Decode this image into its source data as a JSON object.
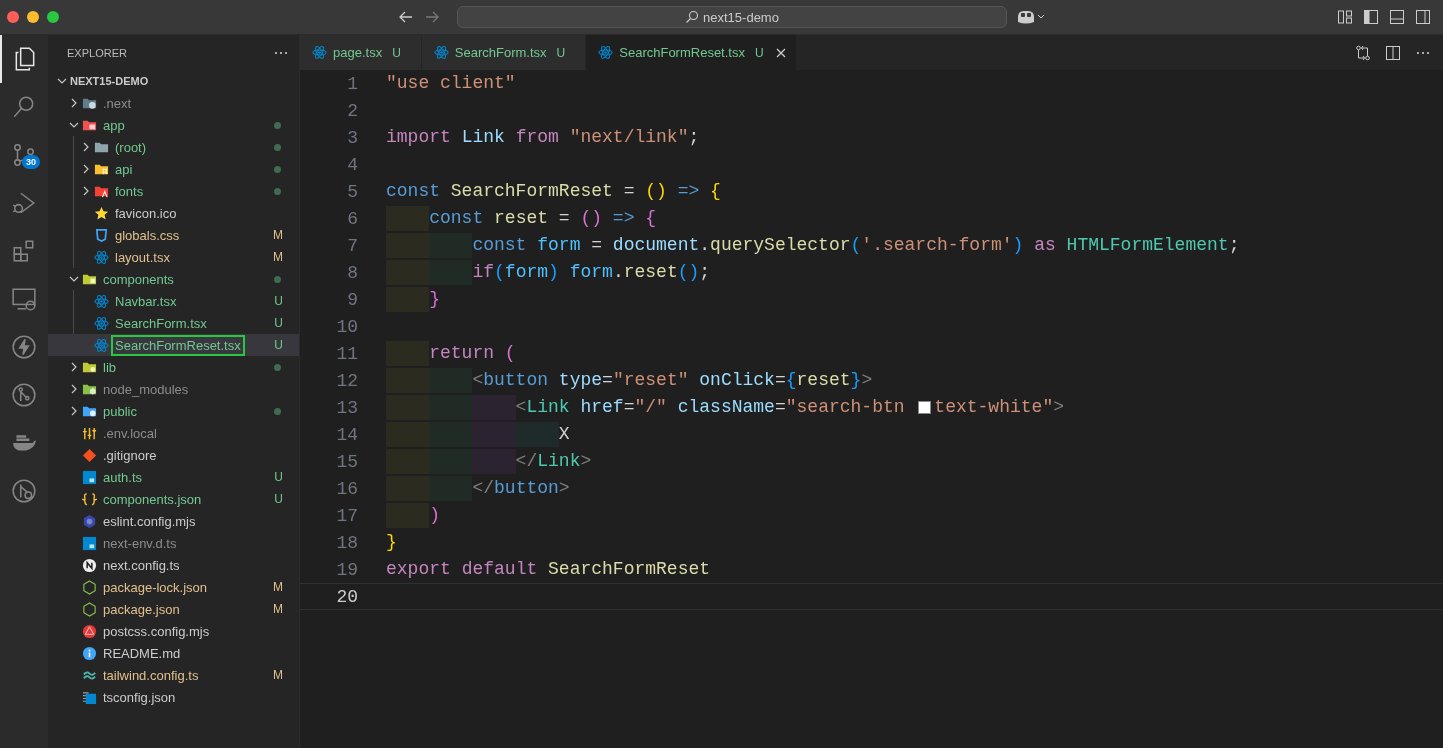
{
  "window": {
    "search": "next15-demo"
  },
  "activity_bar": [
    {
      "kind": "explorer",
      "selected": true
    },
    {
      "kind": "search",
      "selected": false
    },
    {
      "kind": "source-control",
      "selected": false,
      "badge": "30"
    },
    {
      "kind": "debug",
      "selected": false
    },
    {
      "kind": "extensions",
      "selected": false
    },
    {
      "kind": "remote",
      "selected": false
    },
    {
      "kind": "bolt",
      "selected": false
    },
    {
      "kind": "graph",
      "selected": false
    },
    {
      "kind": "docker",
      "selected": false
    },
    {
      "kind": "gitlens",
      "selected": false
    }
  ],
  "explorer": {
    "title": "EXPLORER",
    "root": {
      "label": "NEXT15-DEMO",
      "expanded": true
    },
    "items": [
      {
        "label": ".next",
        "kind": "next-folder",
        "expanded": false,
        "color": "#8c8c8c",
        "dot": false,
        "selected": false
      },
      {
        "label": "app",
        "kind": "app-folder",
        "expanded": true,
        "color": "#73c991",
        "dot": true,
        "selected": false,
        "children": [
          {
            "label": "(root)",
            "kind": "folder",
            "expanded": false,
            "color": "#73c991",
            "dot": true,
            "selected": false
          },
          {
            "label": "api",
            "kind": "api-folder",
            "expanded": false,
            "color": "#73c991",
            "dot": true,
            "selected": false
          },
          {
            "label": "fonts",
            "kind": "font-folder",
            "expanded": false,
            "color": "#73c991",
            "dot": true,
            "selected": false
          },
          {
            "label": "favicon.ico",
            "kind": "star",
            "color": "#cccccc",
            "dot": false,
            "selected": false
          },
          {
            "label": "globals.css",
            "kind": "css",
            "color": "#e2c08d",
            "badge": "M",
            "dot": false,
            "selected": false
          },
          {
            "label": "layout.tsx",
            "kind": "react",
            "color": "#e2c08d",
            "badge": "M",
            "dot": false,
            "selected": false
          }
        ]
      },
      {
        "label": "components",
        "kind": "components-folder",
        "expanded": true,
        "color": "#73c991",
        "dot": true,
        "selected": false,
        "children": [
          {
            "label": "Navbar.tsx",
            "kind": "react",
            "color": "#73c991",
            "badge": "U",
            "dot": false,
            "selected": false
          },
          {
            "label": "SearchForm.tsx",
            "kind": "react",
            "color": "#73c991",
            "badge": "U",
            "dot": false,
            "selected": false
          },
          {
            "label": "SearchFormReset.tsx",
            "kind": "react",
            "color": "#73c991",
            "badge": "U",
            "dot": false,
            "selected": true,
            "outlined": true
          }
        ]
      },
      {
        "label": "lib",
        "kind": "lib-folder",
        "expanded": false,
        "color": "#73c991",
        "dot": true,
        "selected": false
      },
      {
        "label": "node_modules",
        "kind": "node-folder",
        "expanded": false,
        "color": "#8c8c8c",
        "dot": false,
        "selected": false
      },
      {
        "label": "public",
        "kind": "public-folder",
        "expanded": false,
        "color": "#73c991",
        "dot": true,
        "selected": false
      },
      {
        "label": ".env.local",
        "kind": "env",
        "color": "#8c8c8c",
        "dot": false,
        "selected": false
      },
      {
        "label": ".gitignore",
        "kind": "git",
        "color": "#cccccc",
        "dot": false,
        "selected": false
      },
      {
        "label": "auth.ts",
        "kind": "ts",
        "color": "#73c991",
        "badge": "U",
        "dot": false,
        "selected": false
      },
      {
        "label": "components.json",
        "kind": "json",
        "color": "#73c991",
        "badge": "U",
        "dot": false,
        "selected": false
      },
      {
        "label": "eslint.config.mjs",
        "kind": "eslint",
        "color": "#cccccc",
        "dot": false,
        "selected": false
      },
      {
        "label": "next-env.d.ts",
        "kind": "ts",
        "color": "#8c8c8c",
        "dot": false,
        "selected": false
      },
      {
        "label": "next.config.ts",
        "kind": "next",
        "color": "#cccccc",
        "dot": false,
        "selected": false
      },
      {
        "label": "package-lock.json",
        "kind": "npm",
        "color": "#e2c08d",
        "badge": "M",
        "dot": false,
        "selected": false
      },
      {
        "label": "package.json",
        "kind": "npm",
        "color": "#e2c08d",
        "badge": "M",
        "dot": false,
        "selected": false
      },
      {
        "label": "postcss.config.mjs",
        "kind": "postcss",
        "color": "#cccccc",
        "dot": false,
        "selected": false
      },
      {
        "label": "README.md",
        "kind": "info",
        "color": "#cccccc",
        "dot": false,
        "selected": false
      },
      {
        "label": "tailwind.config.ts",
        "kind": "tailwind",
        "color": "#e2c08d",
        "badge": "M",
        "dot": false,
        "selected": false
      },
      {
        "label": "tsconfig.json",
        "kind": "tsconfig",
        "color": "#cccccc",
        "dot": false,
        "selected": false
      }
    ]
  },
  "tabs": [
    {
      "label": "page.tsx",
      "badge": "U",
      "selected": false
    },
    {
      "label": "SearchForm.tsx",
      "badge": "U",
      "selected": false
    },
    {
      "label": "SearchFormReset.tsx",
      "badge": "U",
      "selected": true
    }
  ],
  "editor": {
    "lines": [
      {
        "number": "1",
        "current": false,
        "tokens": [
          {
            "text": "\"use client\"",
            "kind": "string"
          }
        ]
      },
      {
        "number": "2",
        "current": false
      },
      {
        "number": "3",
        "current": false,
        "tokens": [
          {
            "text": "import ",
            "kind": "control"
          },
          {
            "text": "Link ",
            "kind": "variable"
          },
          {
            "text": "from ",
            "kind": "control"
          },
          {
            "text": "\"next/link\"",
            "kind": "string"
          },
          {
            "text": ";",
            "kind": "plain"
          }
        ]
      },
      {
        "number": "4",
        "current": false
      },
      {
        "number": "5",
        "current": false,
        "tokens": [
          {
            "text": "const ",
            "kind": "keyword"
          },
          {
            "text": "SearchFormReset ",
            "kind": "function"
          },
          {
            "text": "= ",
            "kind": "plain"
          },
          {
            "text": "() ",
            "kind": "bracket1"
          },
          {
            "text": "=> ",
            "kind": "keyword"
          },
          {
            "text": "{",
            "kind": "bracket1"
          }
        ]
      },
      {
        "number": "6",
        "current": false,
        "tokens": [
          {
            "text": "    const ",
            "kind": "keyword"
          },
          {
            "text": "reset ",
            "kind": "function"
          },
          {
            "text": "= ",
            "kind": "plain"
          },
          {
            "text": "() ",
            "kind": "bracket2"
          },
          {
            "text": "=> ",
            "kind": "keyword"
          },
          {
            "text": "{",
            "kind": "bracket2"
          }
        ]
      },
      {
        "number": "7",
        "current": false,
        "tokens": [
          {
            "text": "        const ",
            "kind": "keyword"
          },
          {
            "text": "form ",
            "kind": "constant"
          },
          {
            "text": "= ",
            "kind": "plain"
          },
          {
            "text": "document",
            "kind": "variable"
          },
          {
            "text": ".",
            "kind": "plain"
          },
          {
            "text": "querySelector",
            "kind": "function"
          },
          {
            "text": "(",
            "kind": "bracket3"
          },
          {
            "text": "'.search-form'",
            "kind": "string"
          },
          {
            "text": ") ",
            "kind": "bracket3"
          },
          {
            "text": "as ",
            "kind": "control"
          },
          {
            "text": "HTMLFormElement",
            "kind": "type"
          },
          {
            "text": ";",
            "kind": "plain"
          }
        ]
      },
      {
        "number": "8",
        "current": false,
        "tokens": [
          {
            "text": "        if",
            "kind": "control"
          },
          {
            "text": "(",
            "kind": "bracket3"
          },
          {
            "text": "form",
            "kind": "constant"
          },
          {
            "text": ") ",
            "kind": "bracket3"
          },
          {
            "text": "form",
            "kind": "constant"
          },
          {
            "text": ".",
            "kind": "plain"
          },
          {
            "text": "reset",
            "kind": "function"
          },
          {
            "text": "()",
            "kind": "bracket3"
          },
          {
            "text": ";",
            "kind": "plain"
          }
        ]
      },
      {
        "number": "9",
        "current": false,
        "tokens": [
          {
            "text": "    }",
            "kind": "bracket2"
          }
        ]
      },
      {
        "number": "10",
        "current": false
      },
      {
        "number": "11",
        "current": false,
        "tokens": [
          {
            "text": "    return ",
            "kind": "control"
          },
          {
            "text": "(",
            "kind": "bracket2"
          }
        ]
      },
      {
        "number": "12",
        "current": false,
        "tokens": [
          {
            "text": "        <",
            "kind": "tag"
          },
          {
            "text": "button ",
            "kind": "keyword"
          },
          {
            "text": "type",
            "kind": "variable"
          },
          {
            "text": "=",
            "kind": "plain"
          },
          {
            "text": "\"reset\" ",
            "kind": "string"
          },
          {
            "text": "onClick",
            "kind": "variable"
          },
          {
            "text": "=",
            "kind": "plain"
          },
          {
            "text": "{",
            "kind": "bracket3"
          },
          {
            "text": "reset",
            "kind": "function"
          },
          {
            "text": "}",
            "kind": "bracket3"
          },
          {
            "text": ">",
            "kind": "tag"
          }
        ]
      },
      {
        "number": "13",
        "current": false,
        "tokens": [
          {
            "text": "            <",
            "kind": "tag"
          },
          {
            "text": "Link ",
            "kind": "type"
          },
          {
            "text": "href",
            "kind": "variable"
          },
          {
            "text": "=",
            "kind": "plain"
          },
          {
            "text": "\"/\" ",
            "kind": "string"
          },
          {
            "text": "className",
            "kind": "variable"
          },
          {
            "text": "=",
            "kind": "plain"
          },
          {
            "text": "\"search-btn ",
            "kind": "string"
          },
          {
            "kind": "swatch",
            "color": "#ffffff"
          },
          {
            "text": "text-white\"",
            "kind": "string"
          },
          {
            "text": ">",
            "kind": "tag"
          }
        ]
      },
      {
        "number": "14",
        "current": false,
        "tokens": [
          {
            "text": "                X",
            "kind": "plain"
          }
        ]
      },
      {
        "number": "15",
        "current": false,
        "tokens": [
          {
            "text": "            </",
            "kind": "tag"
          },
          {
            "text": "Link",
            "kind": "type"
          },
          {
            "text": ">",
            "kind": "tag"
          }
        ]
      },
      {
        "number": "16",
        "current": false,
        "tokens": [
          {
            "text": "        </",
            "kind": "tag"
          },
          {
            "text": "button",
            "kind": "keyword"
          },
          {
            "text": ">",
            "kind": "tag"
          }
        ]
      },
      {
        "number": "17",
        "current": false,
        "tokens": [
          {
            "text": "    )",
            "kind": "bracket2"
          }
        ]
      },
      {
        "number": "18",
        "current": false,
        "tokens": [
          {
            "text": "}",
            "kind": "bracket1"
          }
        ]
      },
      {
        "number": "19",
        "current": false,
        "tokens": [
          {
            "text": "export ",
            "kind": "control"
          },
          {
            "text": "default ",
            "kind": "control"
          },
          {
            "text": "SearchFormReset",
            "kind": "function"
          }
        ]
      },
      {
        "number": "20",
        "current": true
      }
    ]
  }
}
